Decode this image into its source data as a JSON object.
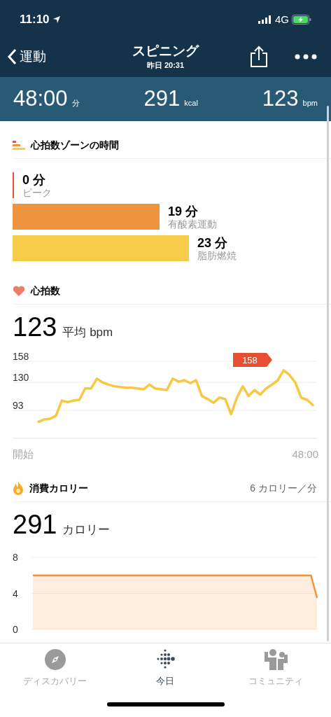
{
  "status_bar": {
    "time": "11:10",
    "network": "4G"
  },
  "nav": {
    "back": "運動",
    "title": "スピニング",
    "subtitle": "昨日 20:31"
  },
  "summary": [
    {
      "value": "48:00",
      "unit": "分"
    },
    {
      "value": "291",
      "unit": "kcal"
    },
    {
      "value": "123",
      "unit": "bpm"
    }
  ],
  "zones": {
    "title": "心拍数ゾーンの時間",
    "items": [
      {
        "minutes": "0 分",
        "label": "ピーク",
        "color": "#e8503a"
      },
      {
        "minutes": "19 分",
        "label": "有酸素運動",
        "color": "#ee943e"
      },
      {
        "minutes": "23 分",
        "label": "脂肪燃焼",
        "color": "#f6cb4a"
      }
    ]
  },
  "heart_rate": {
    "title": "心拍数",
    "value": "123",
    "unit": "平均 bpm",
    "peak_tag": "158",
    "x_labels": [
      "開始",
      "48:00"
    ],
    "chart_data": {
      "type": "line",
      "ylim": [
        56,
        158
      ],
      "yticks": [
        93,
        130,
        158
      ],
      "series": [
        {
          "color": "#f6c844",
          "values": [
            78,
            81,
            82,
            86,
            106,
            104,
            106,
            107,
            122,
            122,
            135,
            130,
            127,
            125,
            124,
            123,
            123,
            122,
            121,
            127,
            122,
            121,
            120,
            135,
            131,
            133,
            129,
            133,
            112,
            108,
            103,
            110,
            108,
            88,
            110,
            125,
            112,
            120,
            114,
            122,
            127,
            133,
            146,
            140,
            130,
            110,
            107,
            100
          ]
        }
      ]
    }
  },
  "calories": {
    "title": "消費カロリー",
    "rate": "6 カロリー／分",
    "value": "291",
    "unit": "カロリー",
    "chart_data": {
      "type": "area",
      "ylim": [
        0,
        8
      ],
      "yticks": [
        0,
        4,
        8
      ],
      "series": [
        {
          "color": "#ef9440",
          "values": [
            6,
            6,
            6,
            6,
            6,
            6,
            6,
            6,
            6,
            6,
            6,
            6,
            6,
            6,
            6,
            6,
            6,
            6,
            6,
            6,
            6,
            6,
            6,
            6,
            6,
            6,
            6,
            6,
            6,
            6,
            6,
            6,
            6,
            6,
            6,
            6,
            6,
            6,
            6,
            6,
            6,
            6,
            6,
            6,
            6,
            6,
            6,
            3.5
          ]
        }
      ]
    }
  },
  "tab_bar": [
    {
      "label": "ディスカバリー",
      "selected": false
    },
    {
      "label": "今日",
      "selected": true
    },
    {
      "label": "コミュニティ",
      "selected": false
    }
  ]
}
